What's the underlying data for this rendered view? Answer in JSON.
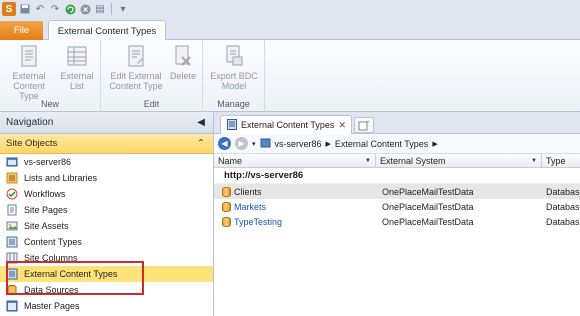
{
  "ribbon": {
    "tabs": {
      "file": "File",
      "active": "External Content Types"
    },
    "groups": [
      {
        "label": "New",
        "buttons": [
          {
            "line1": "External",
            "line2": "Content Type"
          },
          {
            "line1": "External",
            "line2": "List"
          }
        ]
      },
      {
        "label": "Edit",
        "buttons": [
          {
            "line1": "Edit External",
            "line2": "Content Type"
          },
          {
            "line1": "Delete",
            "line2": ""
          }
        ]
      },
      {
        "label": "Manage",
        "buttons": [
          {
            "line1": "Export BDC",
            "line2": "Model"
          }
        ]
      }
    ]
  },
  "navigation": {
    "title": "Navigation",
    "section": "Site Objects",
    "items": [
      {
        "label": "vs-server86",
        "icon": "site-icon"
      },
      {
        "label": "Lists and Libraries",
        "icon": "list-icon"
      },
      {
        "label": "Workflows",
        "icon": "workflow-icon"
      },
      {
        "label": "Site Pages",
        "icon": "pages-icon"
      },
      {
        "label": "Site Assets",
        "icon": "assets-icon"
      },
      {
        "label": "Content Types",
        "icon": "content-types-icon"
      },
      {
        "label": "Site Columns",
        "icon": "columns-icon"
      },
      {
        "label": "External Content Types",
        "icon": "external-content-types-icon"
      },
      {
        "label": "Data Sources",
        "icon": "data-sources-icon"
      },
      {
        "label": "Master Pages",
        "icon": "master-pages-icon"
      }
    ],
    "selected_index": 7
  },
  "main": {
    "tab_label": "External Content Types",
    "breadcrumb": [
      "vs-server86",
      "External Content Types"
    ],
    "columns": [
      "Name",
      "External System",
      "Type"
    ],
    "site_url": "http://vs-server86",
    "rows": [
      {
        "name": "Clients",
        "system": "OnePlaceMailTestData",
        "type": "Database"
      },
      {
        "name": "Markets",
        "system": "OnePlaceMailTestData",
        "type": "Database"
      },
      {
        "name": "TypeTesting",
        "system": "OnePlaceMailTestData",
        "type": "Database"
      }
    ],
    "selected_row": 0
  },
  "colors": {
    "accent_orange": "#e57e13",
    "selection_yellow": "#ffe27a",
    "highlight_red": "#cc2b2b",
    "link_blue": "#1a55b4"
  }
}
